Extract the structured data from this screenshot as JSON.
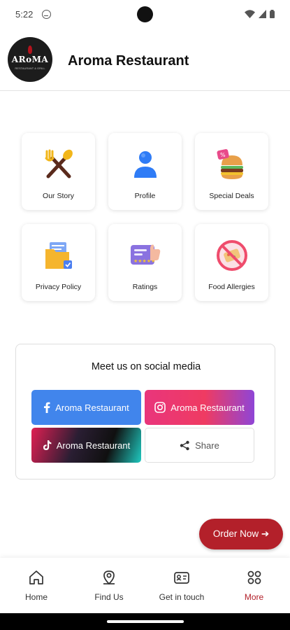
{
  "status_bar": {
    "time": "5:22"
  },
  "header": {
    "logo_text": "ARoMA",
    "logo_subtext": "RESTAURANT & GRILL",
    "title": "Aroma Restaurant"
  },
  "menu_tiles": [
    {
      "label": "Our Story",
      "icon": "fork-spoon-icon"
    },
    {
      "label": "Profile",
      "icon": "user-icon"
    },
    {
      "label": "Special Deals",
      "icon": "burger-deal-icon"
    },
    {
      "label": "Privacy Policy",
      "icon": "folder-policy-icon"
    },
    {
      "label": "Ratings",
      "icon": "rating-thumbs-up-icon"
    },
    {
      "label": "Food Allergies",
      "icon": "no-food-icon"
    }
  ],
  "social": {
    "title": "Meet us on social media",
    "facebook_label": "Aroma Restaurant",
    "instagram_label": "Aroma Restaurant",
    "tiktok_label": "Aroma Restaurant",
    "share_label": "Share"
  },
  "order_now": {
    "label": "Order Now ➔"
  },
  "bottom_nav": {
    "items": [
      {
        "label": "Home",
        "icon": "home-icon"
      },
      {
        "label": "Find Us",
        "icon": "location-pin-icon"
      },
      {
        "label": "Get in touch",
        "icon": "contact-card-icon"
      },
      {
        "label": "More",
        "icon": "grid-more-icon",
        "active": true
      }
    ]
  },
  "colors": {
    "accent": "#b3202a",
    "facebook": "#4185ec",
    "instagram": "#e9357c",
    "text": "#1a1a1a"
  }
}
